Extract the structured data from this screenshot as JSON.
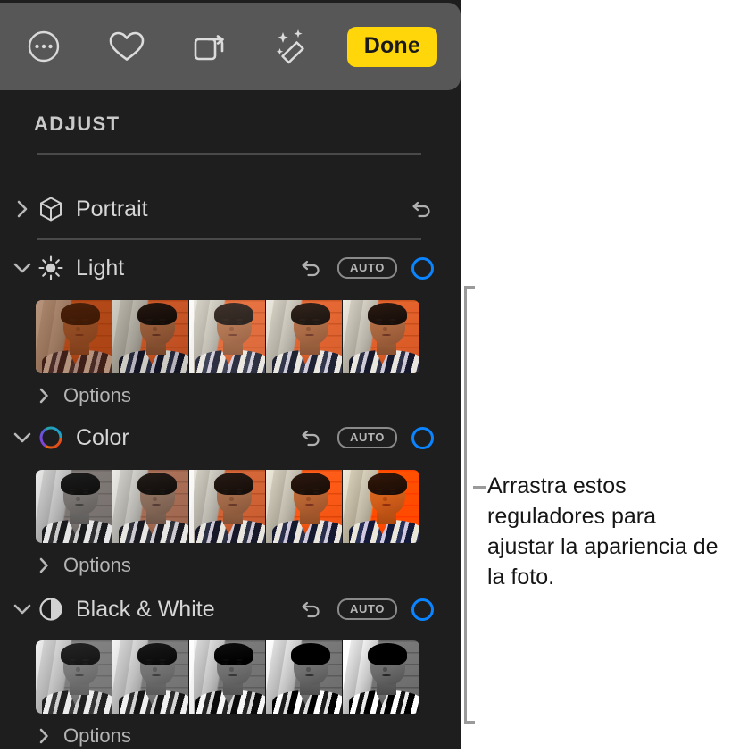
{
  "toolbar": {
    "buttons": [
      {
        "name": "more-options-icon",
        "label": "More options"
      },
      {
        "name": "favorite-heart-icon",
        "label": "Favorite"
      },
      {
        "name": "rotate-icon",
        "label": "Rotate"
      },
      {
        "name": "auto-enhance-wand-icon",
        "label": "Auto Enhance"
      }
    ],
    "done_label": "Done"
  },
  "panel": {
    "header": "ADJUST",
    "auto_label": "AUTO",
    "options_label": "Options",
    "accent_blue": "#0a84ff",
    "done_yellow": "#ffd60a",
    "panel_bg": "#1e1e1e",
    "toolbar_bg": "#575757",
    "sections": [
      {
        "id": "portrait",
        "label": "Portrait",
        "icon": "cube-icon",
        "expanded": false,
        "has_auto": false,
        "has_toggle": false,
        "has_strip": false,
        "has_options": false
      },
      {
        "id": "light",
        "label": "Light",
        "icon": "sun-icon",
        "expanded": true,
        "has_auto": true,
        "has_toggle": true,
        "has_strip": true,
        "has_options": true,
        "strip": {
          "thumb_count": 5,
          "playhead_index": 2,
          "mode": "light"
        }
      },
      {
        "id": "color",
        "label": "Color",
        "icon": "color-wheel-icon",
        "expanded": true,
        "has_auto": true,
        "has_toggle": true,
        "has_strip": true,
        "has_options": true,
        "strip": {
          "thumb_count": 5,
          "playhead_index": 2,
          "mode": "color"
        }
      },
      {
        "id": "black-and-white",
        "label": "Black & White",
        "icon": "contrast-circle-icon",
        "expanded": true,
        "has_auto": true,
        "has_toggle": true,
        "has_strip": true,
        "has_options": true,
        "strip": {
          "thumb_count": 5,
          "playhead_index": 2,
          "mode": "bw"
        }
      }
    ]
  },
  "callout": {
    "text": "Arrastra estos reguladores para ajustar la apariencia de la foto.",
    "bracket_color": "#9a9a9a"
  }
}
